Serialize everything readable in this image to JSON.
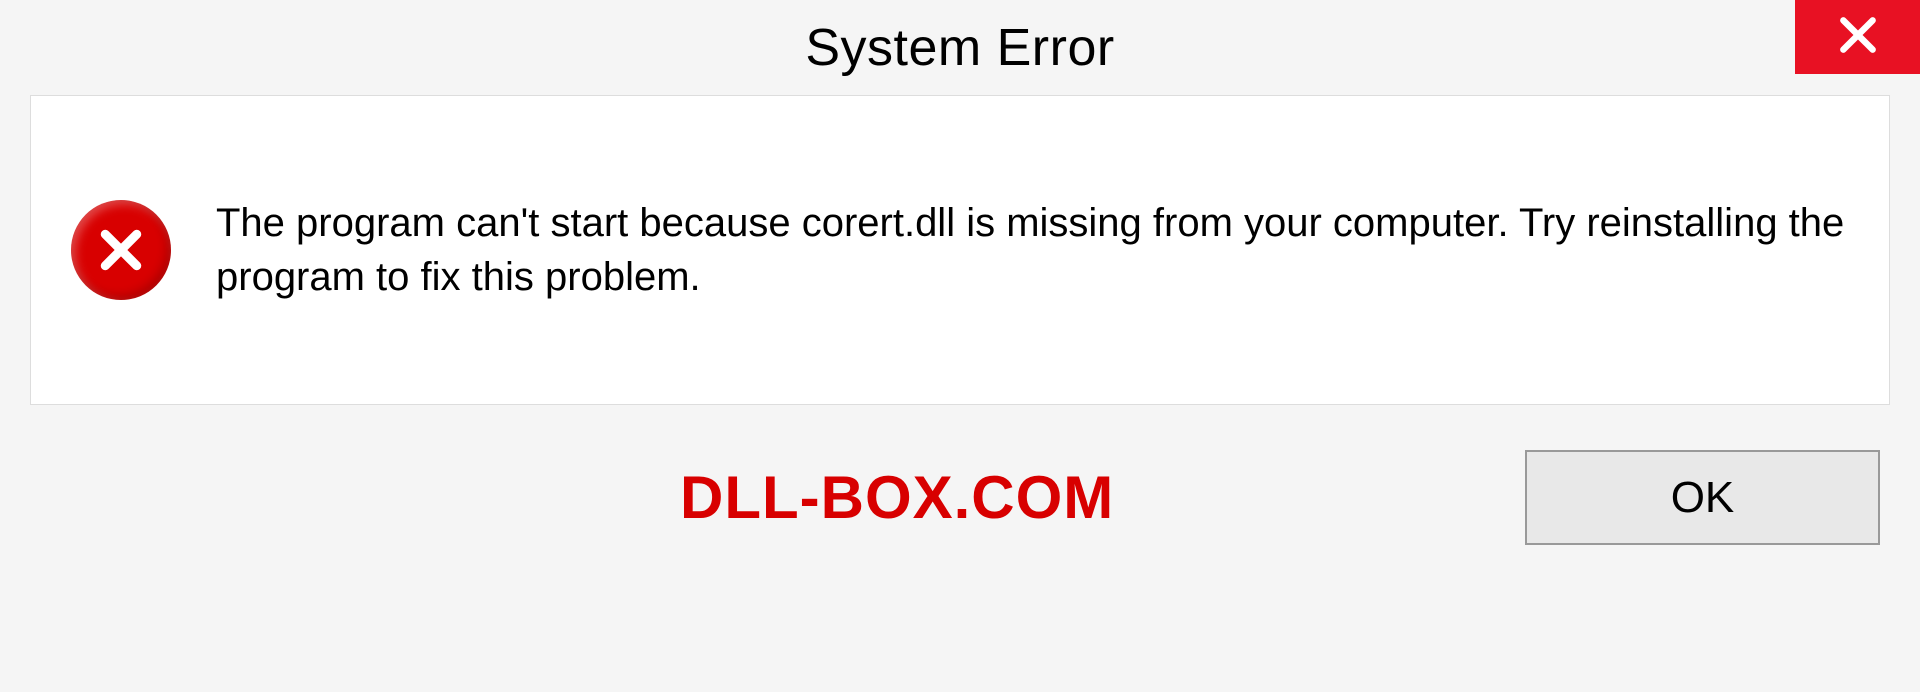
{
  "dialog": {
    "title": "System Error",
    "message": "The program can't start because corert.dll is missing from your computer. Try reinstalling the program to fix this problem.",
    "ok_label": "OK"
  },
  "watermark": "DLL-BOX.COM"
}
